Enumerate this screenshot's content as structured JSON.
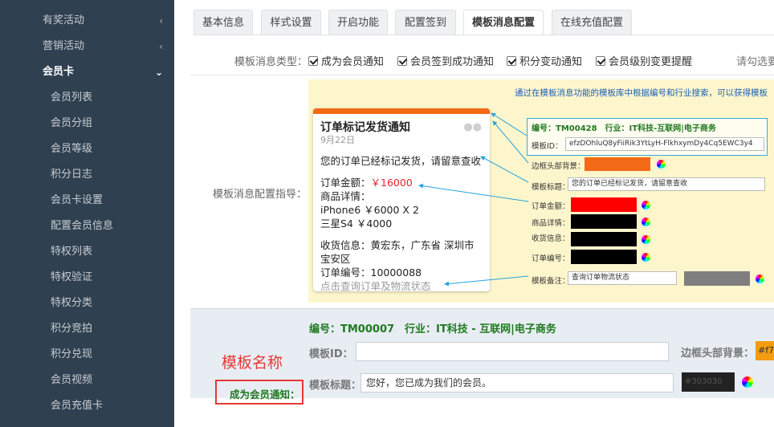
{
  "sidebar": {
    "items": [
      {
        "label": "有奖活动",
        "chevron": "‹"
      },
      {
        "label": "营销活动",
        "chevron": "‹"
      },
      {
        "label": "会员卡",
        "chevron": "⌄"
      }
    ],
    "subitems": [
      {
        "label": "会员列表"
      },
      {
        "label": "会员分组"
      },
      {
        "label": "会员等级"
      },
      {
        "label": "积分日志"
      },
      {
        "label": "会员卡设置"
      },
      {
        "label": "配置会员信息"
      },
      {
        "label": "特权列表"
      },
      {
        "label": "特权验证"
      },
      {
        "label": "特权分类"
      },
      {
        "label": "积分竞拍"
      },
      {
        "label": "积分兑现"
      },
      {
        "label": "会员视频"
      },
      {
        "label": "会员充值卡"
      }
    ]
  },
  "tabs": [
    {
      "label": "基本信息"
    },
    {
      "label": "样式设置"
    },
    {
      "label": "开启功能"
    },
    {
      "label": "配置签到"
    },
    {
      "label": "模板消息配置"
    },
    {
      "label": "在线充值配置"
    }
  ],
  "types": {
    "label": "模板消息类型：",
    "options": [
      {
        "label": "成为会员通知",
        "checked": true
      },
      {
        "label": "会员签到成功通知",
        "checked": true
      },
      {
        "label": "积分变动通知",
        "checked": true
      },
      {
        "label": "会员级别变更提醒",
        "checked": true
      }
    ],
    "hint": "请勾选要"
  },
  "guide": {
    "label": "模板消息配置指导：",
    "card": {
      "title": "订单标记发货通知",
      "date": "9月22日",
      "first": "您的订单已经标记发货，请留意查收",
      "amount_label": "订单金额：",
      "amount": "￥16000",
      "details_label": "商品详情：",
      "item1": "iPhone6 ￥6000 X 2",
      "item2": "三星S4 ￥4000",
      "ship": "收货信息：黄宏东，广东省 深圳市 宝安区",
      "order": "订单编号：10000088",
      "remark": "点击查询订单及物流状态",
      "wechat_icon": "wechat-icon"
    },
    "panel": {
      "note": "通过在模板消息功能的模板库中根据编号和行业搜索，可以获得模板",
      "code": "编号：TM00428　行业：IT科技-互联网|电子商务",
      "id_label": "模板ID：",
      "id_value": "efzDOhluQ8yFiiRik3YtLyH-FlkhxymDy4Cq5EWC3y4",
      "border_label": "边框头部背景：",
      "title_label": "模板标题：",
      "title_value": "您的订单已经标记发货，请留意查收",
      "amount_label": "订单金额：",
      "details_label": "商品详情：",
      "ship_label": "收货信息：",
      "order_label": "订单编号：",
      "remark_label": "模板备注：",
      "remark_value": "查询订单物流状态",
      "colors": {
        "border": "#f26a15",
        "amount": "#ff0000",
        "dark": "#000000",
        "remark": "#7f7f7f"
      }
    }
  },
  "form": {
    "code": "编号：TM00007　行业：IT科技 - 互联网|电子商务",
    "id_label": "模板ID：",
    "id_value": "",
    "border_label": "边框头部背景：",
    "border_value": "#f7",
    "title_label": "模板标题：",
    "title_value": "您好，您已成为我们的会员。",
    "color_value": "#303030",
    "annotation": "模板名称",
    "name_label": "成为会员通知："
  }
}
